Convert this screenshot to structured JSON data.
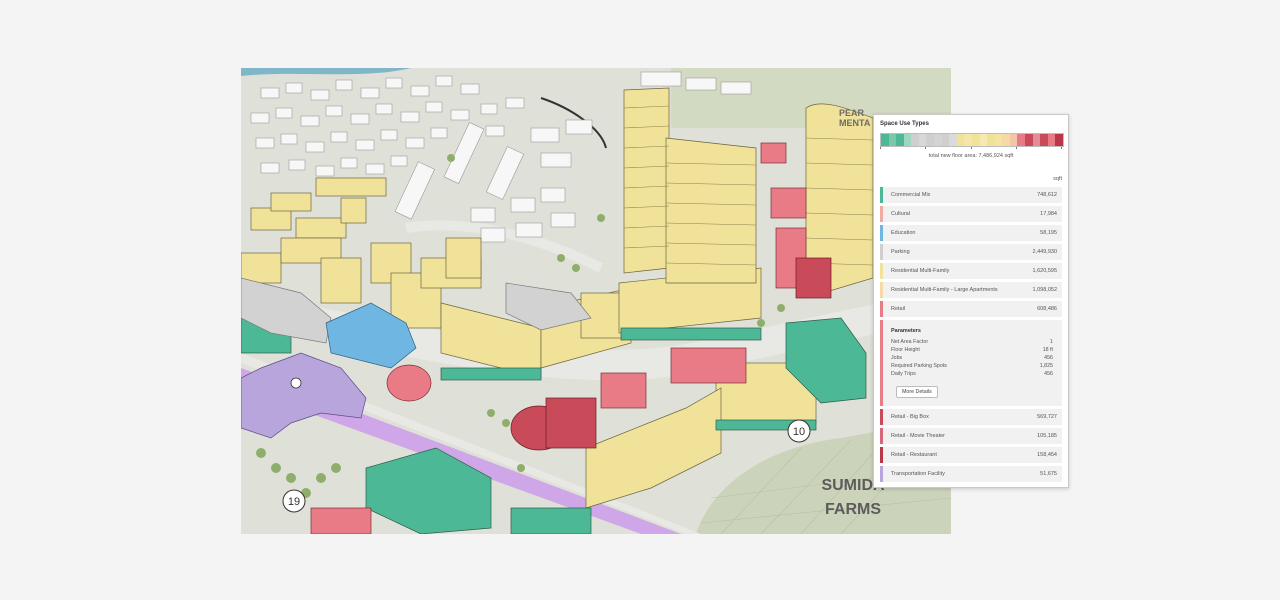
{
  "map": {
    "labels": {
      "area_name": [
        "SUMIDA",
        "FARMS"
      ],
      "area_top": [
        "PEAR",
        "MENTA"
      ]
    },
    "markers": [
      "10",
      "19"
    ],
    "colors": {
      "residential": "#f1e29a",
      "commercial": "#4db896",
      "retail": "#e97b86",
      "retail_big": "#c94a58",
      "education": "#6fb6e3",
      "parking": "#cfcfcf",
      "transport": "#b7a5dc",
      "road": "#e2e3de",
      "grass": "#c8d0b5"
    }
  },
  "panel": {
    "title": "Space Use Types",
    "total_label": "total new floor area: 7,486,924 sqft",
    "unit": "sqft",
    "colorbar": [
      "#4db896",
      "#7ac7a9",
      "#4db896",
      "#9fd6bf",
      "#cfcfcf",
      "#d8d8d8",
      "#cfcfcf",
      "#d4d4d4",
      "#cfcfcf",
      "#dadada",
      "#f1e29a",
      "#f4e6a8",
      "#f1e29a",
      "#f7e9b4",
      "#f1e29a",
      "#f3e4a0",
      "#f6d9a6",
      "#f1c7a6",
      "#e97b86",
      "#c94a58",
      "#e28e98",
      "#c94a58",
      "#e97b86",
      "#b8384a"
    ],
    "rows_before": [
      {
        "name": "Commercial Mix",
        "value": "748,612",
        "color": "#4db896"
      },
      {
        "name": "Cultural",
        "value": "17,984",
        "color": "#f4a9a0"
      },
      {
        "name": "Education",
        "value": "58,195",
        "color": "#6fb6e3"
      },
      {
        "name": "Parking",
        "value": "2,449,930",
        "color": "#cfcfcf"
      },
      {
        "name": "Residential Multi-Family",
        "value": "1,620,595",
        "color": "#f1e29a"
      },
      {
        "name": "Residential Multi-Family - Large Apartments",
        "value": "1,098,052",
        "color": "#f6d9a6"
      },
      {
        "name": "Retail",
        "value": "608,486",
        "color": "#e97b86"
      }
    ],
    "params": {
      "title": "Parameters",
      "items": [
        {
          "label": "Net Area Factor",
          "value": "1"
        },
        {
          "label": "Floor Height",
          "value": "18 ft"
        },
        {
          "label": "Jobs",
          "value": "456"
        },
        {
          "label": "Required Parking Spots",
          "value": "1,825"
        },
        {
          "label": "Daily Trips",
          "value": "456"
        }
      ],
      "more_label": "More Details"
    },
    "rows_after": [
      {
        "name": "Retail - Big Box",
        "value": "569,727",
        "color": "#c94a58"
      },
      {
        "name": "Retail - Movie Theater",
        "value": "105,185",
        "color": "#d9667a"
      },
      {
        "name": "Retail - Restaurant",
        "value": "158,454",
        "color": "#b8384a"
      },
      {
        "name": "Transportation Facility",
        "value": "51,675",
        "color": "#b7a5dc"
      }
    ]
  }
}
